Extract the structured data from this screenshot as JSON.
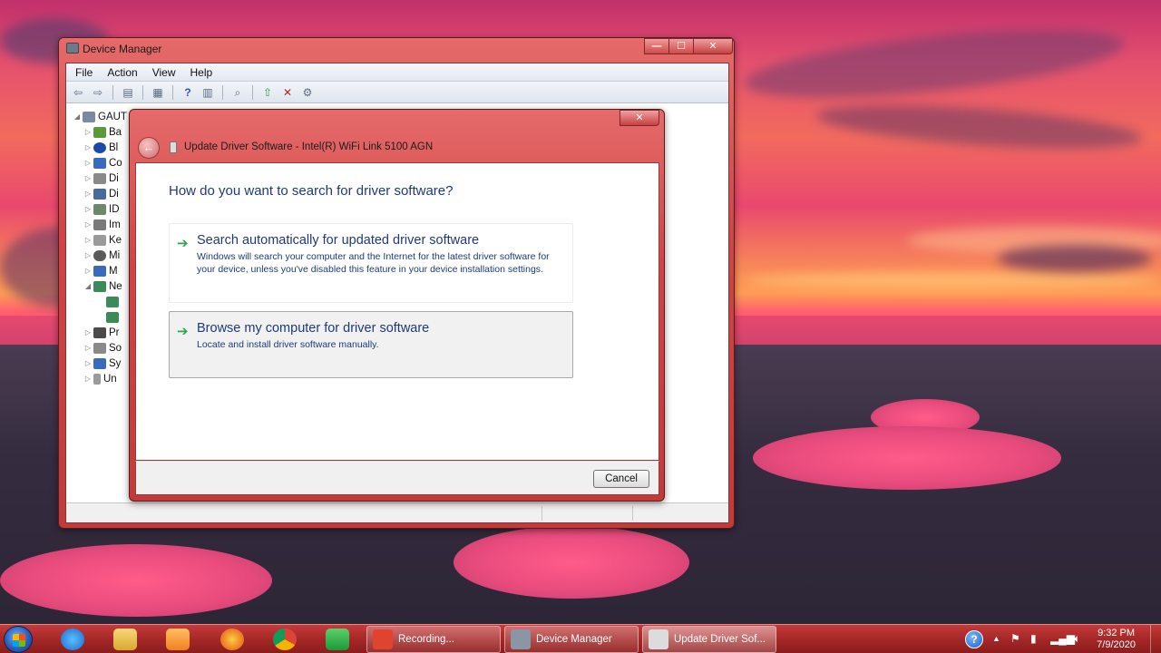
{
  "device_manager": {
    "title": "Device Manager",
    "menu": [
      "File",
      "Action",
      "View",
      "Help"
    ],
    "tree": [
      {
        "label": "GAUT",
        "expander": "◢"
      },
      {
        "label": "Ba",
        "expander": "▷"
      },
      {
        "label": "Bl",
        "expander": "▷"
      },
      {
        "label": "Co",
        "expander": "▷"
      },
      {
        "label": "Di",
        "expander": "▷"
      },
      {
        "label": "Di",
        "expander": "▷"
      },
      {
        "label": "ID",
        "expander": "▷"
      },
      {
        "label": "Im",
        "expander": "▷"
      },
      {
        "label": "Ke",
        "expander": "▷"
      },
      {
        "label": "Mi",
        "expander": "▷"
      },
      {
        "label": "M",
        "expander": "▷"
      },
      {
        "label": "Ne",
        "expander": "◢"
      },
      {
        "label": "",
        "expander": ""
      },
      {
        "label": "",
        "expander": ""
      },
      {
        "label": "Pr",
        "expander": "▷"
      },
      {
        "label": "So",
        "expander": "▷"
      },
      {
        "label": "Sy",
        "expander": "▷"
      },
      {
        "label": "Un",
        "expander": "▷"
      }
    ]
  },
  "update_dialog": {
    "title": "Update Driver Software - Intel(R) WiFi Link 5100 AGN",
    "heading": "How do you want to search for driver software?",
    "option_auto": {
      "title": "Search automatically for updated driver software",
      "description": "Windows will search your computer and the Internet for the latest driver software for your device, unless you've disabled this feature in your device installation settings."
    },
    "option_browse": {
      "title": "Browse my computer for driver software",
      "description": "Locate and install driver software manually."
    },
    "cancel_label": "Cancel",
    "close_glyph": "✕"
  },
  "taskbar": {
    "buttons": [
      {
        "label": "Recording...",
        "icon": "camtasia-recorder-icon",
        "color": "#e0442e"
      },
      {
        "label": "Device Manager",
        "icon": "device-manager-icon",
        "color": "#8a96a6"
      },
      {
        "label": "Update Driver Sof...",
        "icon": "update-driver-icon",
        "color": "#dcdcdc"
      }
    ],
    "time": "9:32 PM",
    "date": "7/9/2020"
  },
  "window_controls": {
    "minimize": "—",
    "maximize": "☐",
    "close": "✕"
  }
}
